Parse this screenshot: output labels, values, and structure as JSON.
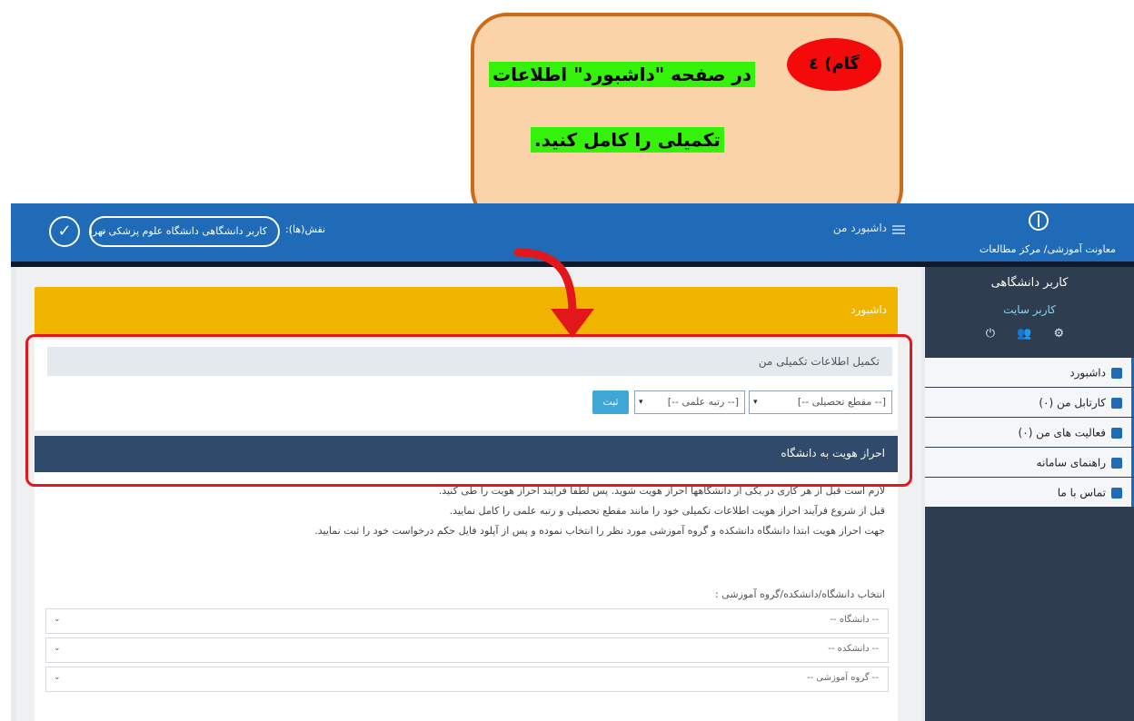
{
  "callout": {
    "step_label": "گام) ٤",
    "line1": "در صفحه \"داشبورد\" اطلاعات",
    "line2": "تکمیلی را کامل کنید."
  },
  "topbar": {
    "brand_org": "معاونت آموزشی/ مرکز مطالعات",
    "page_title": "داشبورد من",
    "role_label": "نقش(ها):",
    "role_value": "کاربر دانشگاهی دانشگاه علوم پزشکی تهران",
    "check_glyph": "✓"
  },
  "sidebar": {
    "user_name": "کاربر دانشگاهی",
    "user_role": "کاربر سایت",
    "icons": "⚙ 👥 ⏻",
    "items": [
      {
        "label": "داشبورد"
      },
      {
        "label": "کارتابل من (۰)"
      },
      {
        "label": "فعالیت های من (۰)"
      },
      {
        "label": "راهنمای سامانه"
      },
      {
        "label": "تماس با ما"
      }
    ]
  },
  "main": {
    "dashboard_header": "داشبورد",
    "complete_info_title": "تکمیل اطلاعات تکمیلی من",
    "degree_select": "[-- مقطع تحصیلی --]",
    "rank_select": "[-- رتبه علمی --]",
    "submit_label": "ثبت",
    "auth_header": "احراز هویت به دانشگاه",
    "auth_para1": "لازم است قبل از هر کاری در یکی از دانشگاهها احراز هویت شوید. پس لطفا فرایند احراز هویت را طی کنید.",
    "auth_para2": "قبل از شروع فرآیند احراز هویت اطلاعات تکمیلی خود را مانند مقطع تحصیلی و رتبه علمی را کامل نمایید.",
    "auth_para3": "جهت احراز هویت ابتدا دانشگاه دانشکده و گروه آموزشی مورد نظر را انتخاب نموده و پس از آپلود فایل حکم درخواست خود را ثبت نمایید.",
    "select_label": "انتخاب دانشگاه/دانشکده/گروه آموزشی :",
    "university_select": "-- دانشگاه --",
    "faculty_select": "-- دانشکده --",
    "group_select": "-- گروه آموزشی --"
  },
  "colors": {
    "topbar": "#1f6bb8",
    "sidebar": "#2e3e50",
    "dashboard_header": "#f0b400",
    "highlight_border": "#e3161b",
    "callout_fill": "#fbd3a8",
    "callout_border": "#cc6b18",
    "text_highlight": "#35f20a"
  }
}
